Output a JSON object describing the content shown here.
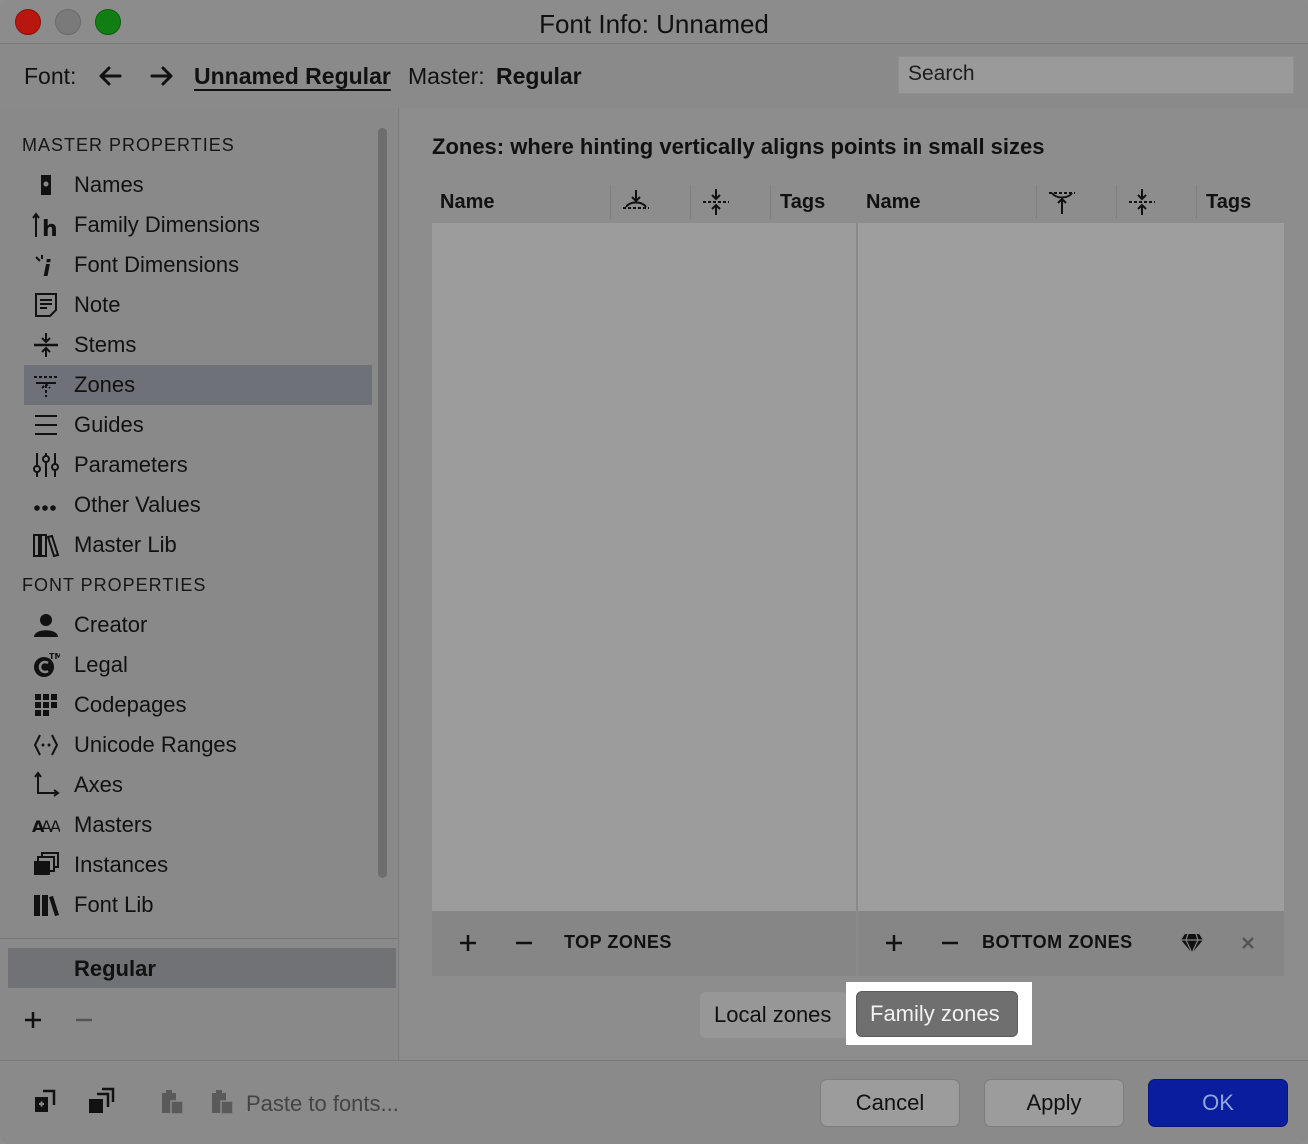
{
  "window": {
    "title": "Font Info: Unnamed"
  },
  "toolbar": {
    "font_label": "Font:",
    "font_name": "Unnamed Regular",
    "master_label": "Master:",
    "master_name": "Regular",
    "search_placeholder": "Search"
  },
  "sidebar": {
    "master_section": "MASTER PROPERTIES",
    "master_items": [
      {
        "label": "Names",
        "icon": "tag-icon"
      },
      {
        "label": "Family Dimensions",
        "icon": "family-dimensions-icon"
      },
      {
        "label": "Font Dimensions",
        "icon": "font-dimensions-icon"
      },
      {
        "label": "Note",
        "icon": "note-icon"
      },
      {
        "label": "Stems",
        "icon": "stems-icon"
      },
      {
        "label": "Zones",
        "icon": "zones-icon",
        "selected": true
      },
      {
        "label": "Guides",
        "icon": "guides-icon"
      },
      {
        "label": "Parameters",
        "icon": "sliders-icon"
      },
      {
        "label": "Other Values",
        "icon": "ellipsis-icon"
      },
      {
        "label": "Master Lib",
        "icon": "books-icon"
      }
    ],
    "font_section": "FONT PROPERTIES",
    "font_items": [
      {
        "label": "Creator",
        "icon": "person-icon"
      },
      {
        "label": "Legal",
        "icon": "copyright-icon"
      },
      {
        "label": "Codepages",
        "icon": "grid-icon"
      },
      {
        "label": "Unicode Ranges",
        "icon": "unicode-ranges-icon"
      },
      {
        "label": "Axes",
        "icon": "axes-icon"
      },
      {
        "label": "Masters",
        "icon": "masters-icon"
      },
      {
        "label": "Instances",
        "icon": "instances-icon"
      },
      {
        "label": "Font Lib",
        "icon": "font-lib-icon"
      }
    ],
    "masters_list": [
      "Regular"
    ]
  },
  "main": {
    "heading": "Zones: where hinting vertically aligns points in small sizes",
    "columns": {
      "name": "Name",
      "tags": "Tags"
    },
    "top_zones_label": "TOP ZONES",
    "bottom_zones_label": "BOTTOM ZONES",
    "segment": {
      "local": "Local zones",
      "family": "Family zones",
      "selected": "Family zones"
    }
  },
  "bottom": {
    "paste_label": "Paste to fonts...",
    "cancel": "Cancel",
    "apply": "Apply",
    "ok": "OK"
  },
  "colors": {
    "ok_button": "#0a1d9c",
    "selected_row": "#6e7178"
  }
}
